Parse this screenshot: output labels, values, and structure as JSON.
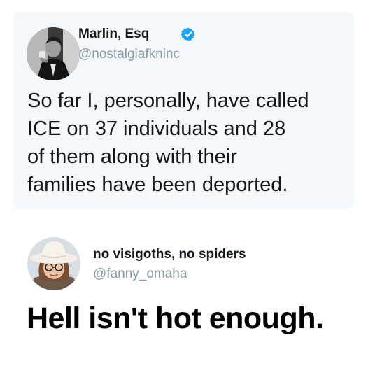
{
  "tweet": {
    "author_name": "Marlin, Esq",
    "author_handle": "@nostalgiafkninc",
    "verified": true,
    "text_lines": [
      "So far I, personally, have called",
      "ICE on 37 individuals and 28",
      "of them along with their",
      "families have been deported."
    ],
    "card_background": "#f5f8fa"
  },
  "reply": {
    "author_name": "no visigoths, no spiders",
    "author_handle": "@fanny_omaha",
    "text": "Hell isn't hot enough."
  },
  "colors": {
    "text_primary": "#14171a",
    "handle_gray": "#8899a6",
    "verified_blue": "#1da1f2"
  },
  "icons": {
    "verified": "verified-badge-icon"
  }
}
